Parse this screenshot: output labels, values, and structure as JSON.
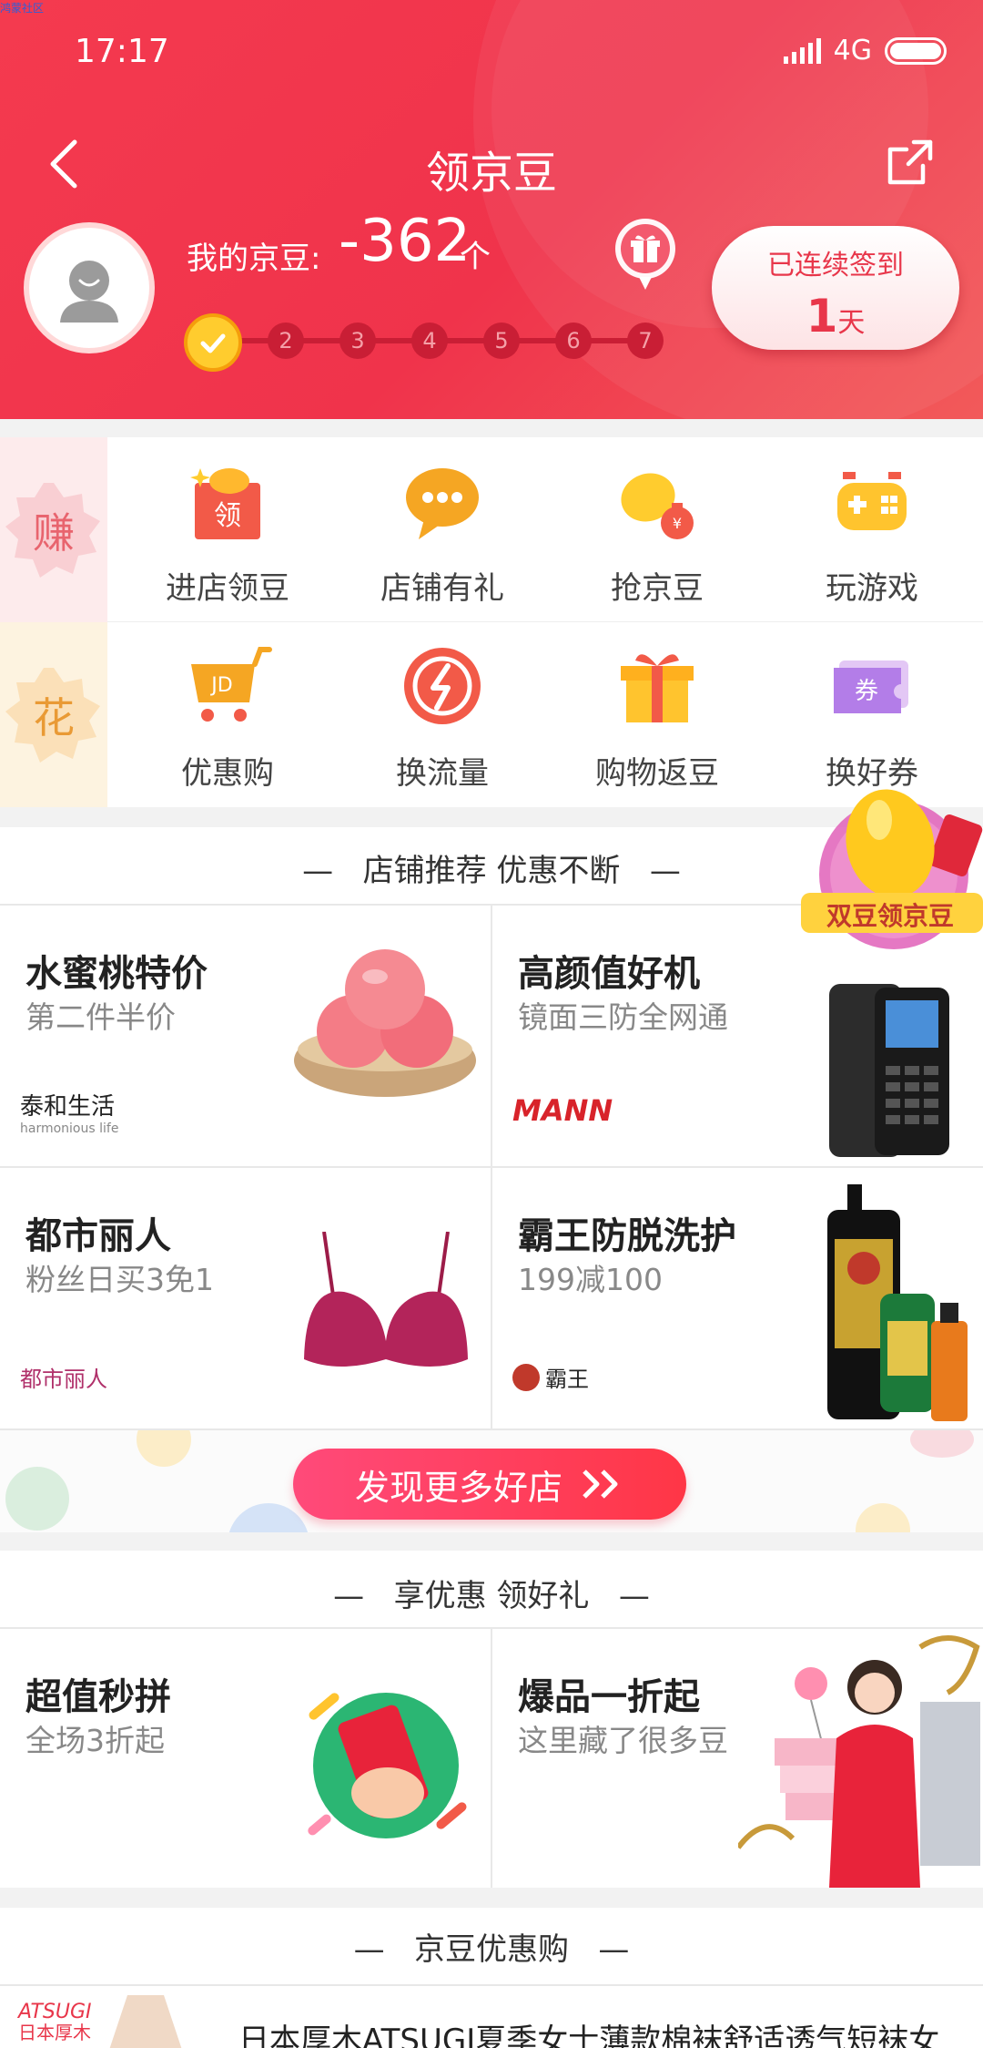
{
  "watermark": "鸿蒙社区",
  "status_bar": {
    "time": "17:17",
    "network": "4G"
  },
  "header": {
    "title": "领京豆"
  },
  "beans": {
    "label": "我的京豆:",
    "value": "-362",
    "unit": "个"
  },
  "checkin": {
    "label": "已连续签到",
    "days": "1",
    "unit": "天"
  },
  "steps": [
    "2",
    "3",
    "4",
    "5",
    "6",
    "7"
  ],
  "earn_row": {
    "tag": "赚",
    "items": [
      {
        "label": "进店领豆",
        "icon": "store-bean-icon"
      },
      {
        "label": "店铺有礼",
        "icon": "chat-gift-icon"
      },
      {
        "label": "抢京豆",
        "icon": "bean-bag-icon"
      },
      {
        "label": "玩游戏",
        "icon": "gamepad-icon"
      }
    ]
  },
  "spend_row": {
    "tag": "花",
    "items": [
      {
        "label": "优惠购",
        "icon": "jd-cart-icon"
      },
      {
        "label": "换流量",
        "icon": "data-flow-icon"
      },
      {
        "label": "购物返豆",
        "icon": "gift-box-icon"
      },
      {
        "label": "换好券",
        "icon": "coupon-icon"
      }
    ]
  },
  "float_badge": {
    "label": "双豆领京豆"
  },
  "store_section": {
    "title": "店铺推荐 优惠不断",
    "tiles": [
      {
        "title": "水蜜桃特价",
        "subtitle": "第二件半价",
        "brand": "泰和生活",
        "brand_sub": "harmonious life"
      },
      {
        "title": "高颜值好机",
        "subtitle": "镜面三防全网通",
        "brand": "MANN"
      },
      {
        "title": "都市丽人",
        "subtitle": "粉丝日买3免1",
        "brand": "都市丽人"
      },
      {
        "title": "霸王防脱洗护",
        "subtitle": "199减100",
        "brand": "霸王"
      }
    ],
    "more_button": "发现更多好店"
  },
  "promo_section": {
    "title": "享优惠 领好礼",
    "tiles": [
      {
        "title": "超值秒拼",
        "subtitle": "全场3折起"
      },
      {
        "title": "爆品一折起",
        "subtitle": "这里藏了很多豆"
      }
    ]
  },
  "bean_shop": {
    "title": "京豆优惠购",
    "item": {
      "brand": "ATSUGI",
      "brand_cn": "日本厚木",
      "text": "日本厚木ATSUGI夏季女士薄款棉袜舒适透气短袜女"
    }
  },
  "colors": {
    "primary": "#f0334b",
    "earn": "#e8646e",
    "spend": "#e99a35"
  }
}
